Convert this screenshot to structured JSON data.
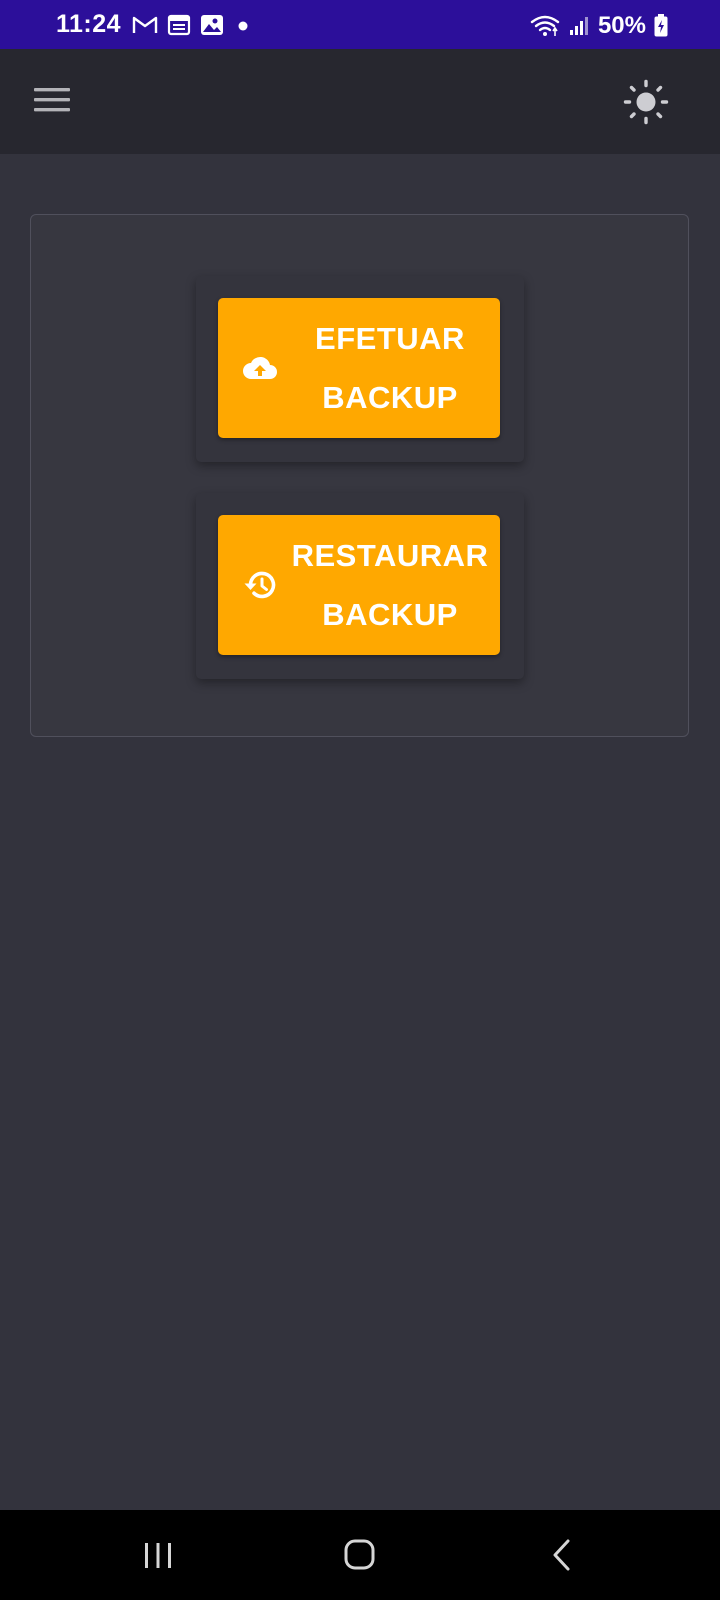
{
  "status_bar": {
    "time": "11:24",
    "battery": "50%",
    "icons_left": [
      "gmail-icon",
      "calendar-icon",
      "gallery-icon",
      "notification-dot-icon"
    ],
    "icons_right": [
      "wifi-icon",
      "signal-icon",
      "battery-icon"
    ]
  },
  "app_bar": {
    "icons": [
      "menu-icon",
      "theme-toggle-icon"
    ]
  },
  "actions": {
    "backup": {
      "line1": "EFETUAR",
      "line2": "BACKUP",
      "icon": "cloud-upload-icon"
    },
    "restore": {
      "line1": "RESTAURAR",
      "line2": "BACKUP",
      "icon": "history-restore-icon"
    }
  },
  "nav_bar": {
    "icons": [
      "recents-icon",
      "home-icon",
      "back-icon"
    ]
  },
  "colors": {
    "status_bar": "#2c0f9a",
    "app_bar": "#27272f",
    "background": "#33333d",
    "button": "#ffa800",
    "text": "#ffffff"
  }
}
